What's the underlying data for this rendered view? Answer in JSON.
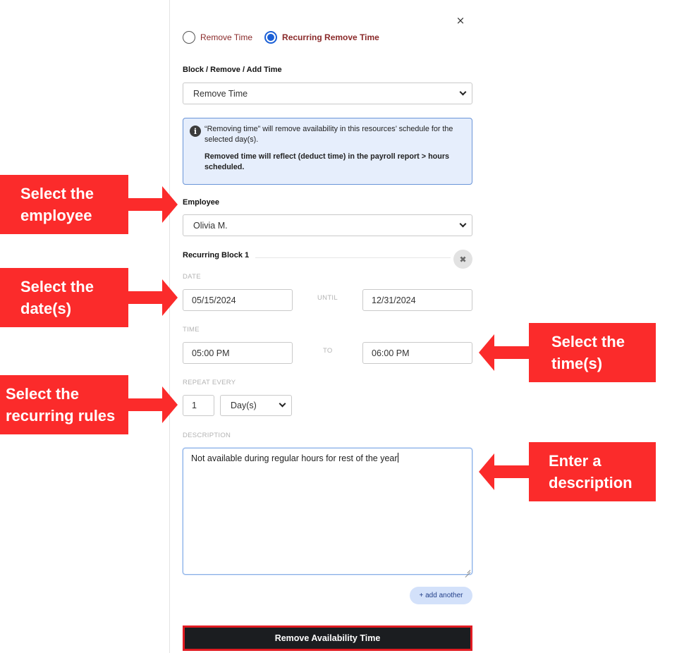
{
  "modal": {
    "close_glyph": "×",
    "mode_options": [
      {
        "label": "Remove Time",
        "selected": false
      },
      {
        "label": "Recurring Remove Time",
        "selected": true
      }
    ],
    "block_type": {
      "label": "Block / Remove / Add Time",
      "value": "Remove Time"
    },
    "info": {
      "icon": "info-icon",
      "text": "“Removing time” will remove availability in this resources’ schedule for the selected day(s).",
      "bold_text": "Removed time will reflect (deduct time) in the payroll report > hours scheduled."
    },
    "employee": {
      "label": "Employee",
      "value": "Olivia M."
    },
    "recurring_block": {
      "title": "Recurring Block 1",
      "remove_glyph": "✖",
      "date": {
        "label": "DATE",
        "start": "05/15/2024",
        "separator": "UNTIL",
        "end": "12/31/2024"
      },
      "time": {
        "label": "TIME",
        "start": "05:00 PM",
        "separator": "TO",
        "end": "06:00 PM"
      },
      "repeat": {
        "label": "REPEAT EVERY",
        "count": "1",
        "unit": "Day(s)"
      },
      "description": {
        "label": "DESCRIPTION",
        "value": "Not available during regular hours for rest of the year"
      }
    },
    "add_another_label": "+ add another",
    "submit_label": "Remove Availability Time"
  },
  "callouts": {
    "employee": [
      "Select the",
      "employee"
    ],
    "dates": [
      "Select the",
      "date(s)"
    ],
    "times": [
      "Select the",
      "time(s)"
    ],
    "rules": [
      "Select the",
      "recurring rules"
    ],
    "description": [
      "Enter a",
      "description"
    ]
  },
  "colors": {
    "accent_blue": "#1a5fd6",
    "callout_red": "#fb2b2b",
    "button_dark": "#1b1d20",
    "info_bg": "#e6eefc"
  }
}
